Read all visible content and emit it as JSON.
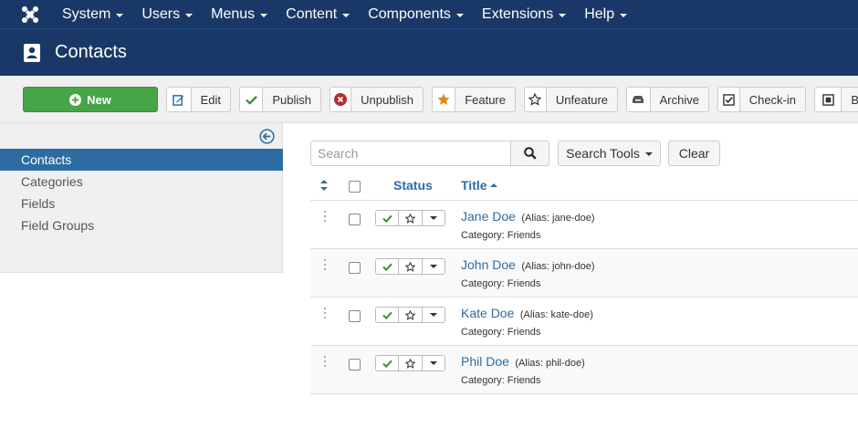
{
  "nav": {
    "menu": [
      {
        "label": "System"
      },
      {
        "label": "Users"
      },
      {
        "label": "Menus"
      },
      {
        "label": "Content"
      },
      {
        "label": "Components"
      },
      {
        "label": "Extensions"
      },
      {
        "label": "Help"
      }
    ]
  },
  "header": {
    "title": "Contacts"
  },
  "toolbar": {
    "new": "New",
    "edit": "Edit",
    "publish": "Publish",
    "unpublish": "Unpublish",
    "feature": "Feature",
    "unfeature": "Unfeature",
    "archive": "Archive",
    "checkin": "Check-in",
    "batch": "B"
  },
  "sidebar": {
    "items": [
      {
        "label": "Contacts",
        "active": true
      },
      {
        "label": "Categories"
      },
      {
        "label": "Fields"
      },
      {
        "label": "Field Groups"
      }
    ]
  },
  "filters": {
    "search_placeholder": "Search",
    "search_tools": "Search Tools",
    "clear": "Clear"
  },
  "table": {
    "headers": {
      "status": "Status",
      "title": "Title"
    },
    "rows": [
      {
        "name": "Jane Doe",
        "alias": "(Alias: jane-doe)",
        "category": "Category: Friends"
      },
      {
        "name": "John Doe",
        "alias": "(Alias: john-doe)",
        "category": "Category: Friends"
      },
      {
        "name": "Kate Doe",
        "alias": "(Alias: kate-doe)",
        "category": "Category: Friends"
      },
      {
        "name": "Phil Doe",
        "alias": "(Alias: phil-doe)",
        "category": "Category: Friends"
      }
    ]
  },
  "colors": {
    "navbar": "#1a3867",
    "new_button": "#46a546",
    "link": "#2d6ca2",
    "publish_check": "#3a8a3a",
    "unpublish_icon": "#b32d2e",
    "feature_star": "#e08a1e"
  }
}
